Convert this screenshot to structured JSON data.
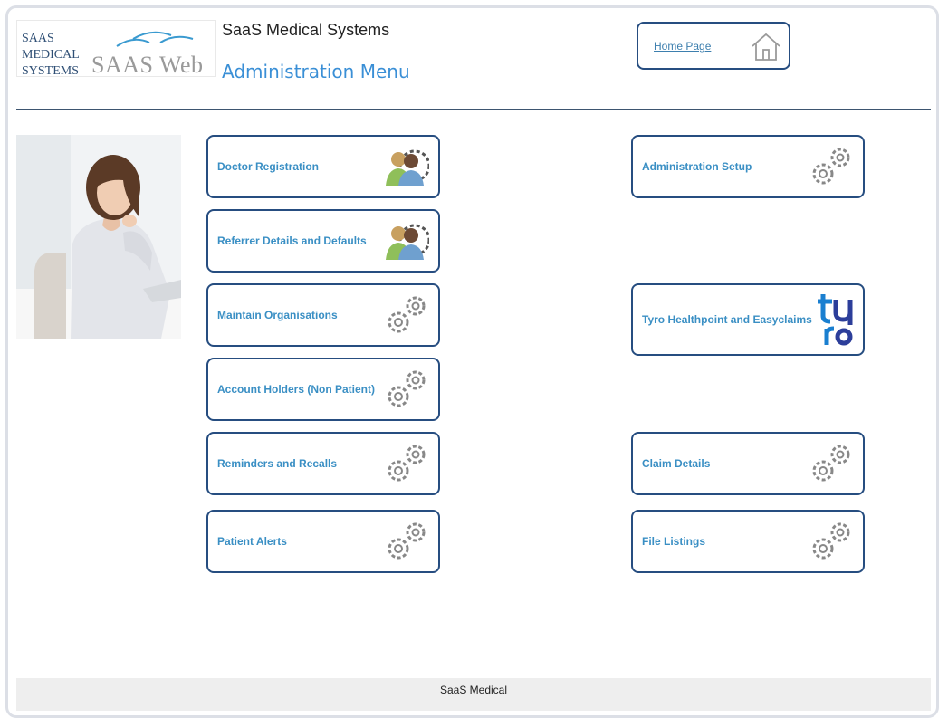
{
  "header": {
    "logo": {
      "line1": "SAAS",
      "line2": "MEDICAL",
      "line3": "SYSTEMS",
      "web": "SAAS Web"
    },
    "company": "SaaS Medical Systems",
    "menu_title": "Administration Menu",
    "home_label": "Home Page"
  },
  "tiles": {
    "doctor_registration": "Doctor Registration",
    "referrer_details": "Referrer Details and Defaults",
    "maintain_organisations": "Maintain Organisations",
    "account_holders": "Account Holders (Non Patient)",
    "reminders_recalls": "Reminders and Recalls",
    "patient_alerts": "Patient Alerts",
    "administration_setup": "Administration Setup",
    "tyro": "Tyro Healthpoint and Easyclaims",
    "claim_details": "Claim Details",
    "file_listings": "File Listings"
  },
  "icons": {
    "people": "people-gear-icon",
    "gears": "gears-icon",
    "tyro": "tyro-logo-icon",
    "home": "home-icon"
  },
  "footer": {
    "text": "SaaS Medical"
  },
  "colors": {
    "accent": "#264d80",
    "label": "#3a8fc4",
    "title": "#3a8fd6"
  }
}
